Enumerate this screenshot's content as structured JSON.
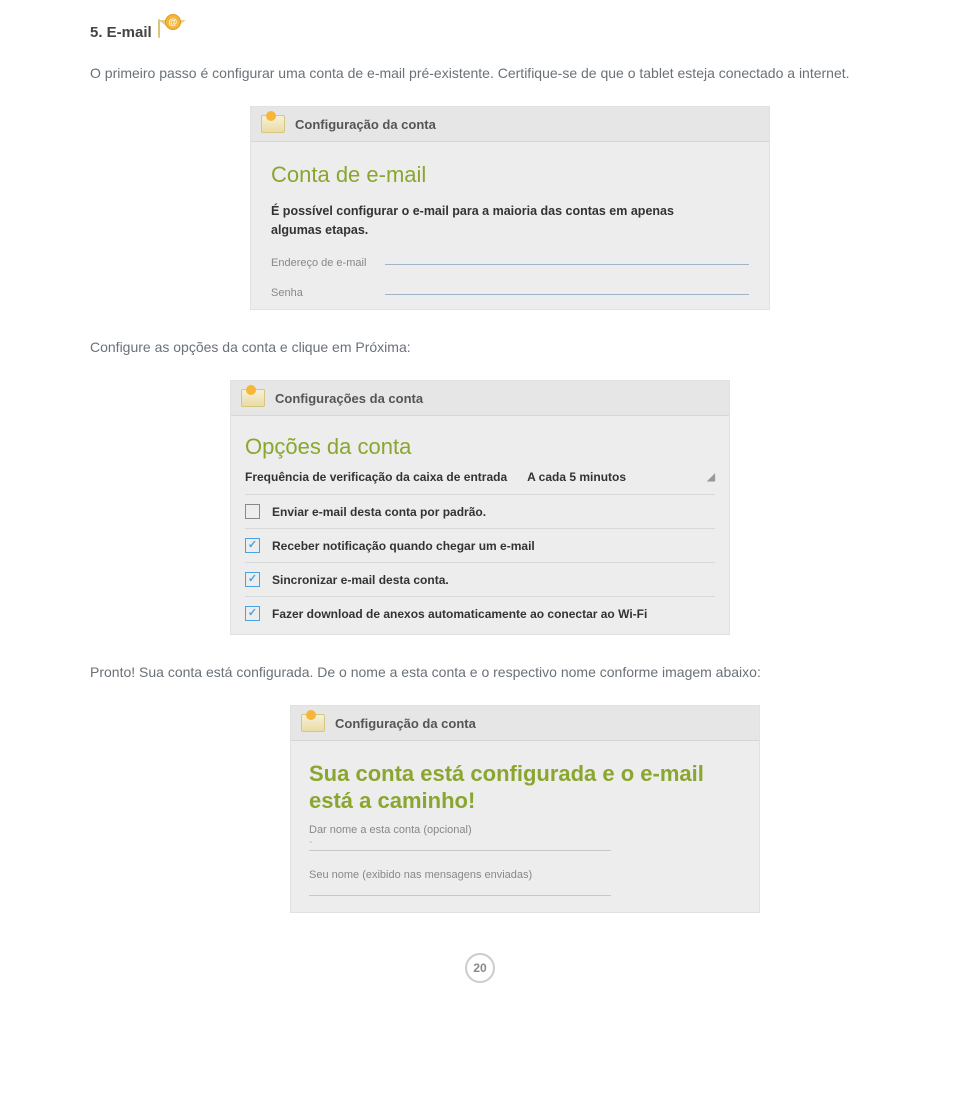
{
  "heading": "5. E-mail",
  "intro": "O primeiro passo é configurar uma conta de e-mail pré-existente. Certifique-se de que o tablet esteja conectado a internet.",
  "shot1": {
    "titlebar": "Configuração da conta",
    "title": "Conta de e-mail",
    "desc": "É possível configurar o e-mail para a maioria das contas em apenas algumas etapas.",
    "field_email": "Endereço de e-mail",
    "field_password": "Senha"
  },
  "mid_text": "Configure as opções da conta e clique em Próxima:",
  "shot2": {
    "titlebar": "Configurações da conta",
    "title": "Opções da conta",
    "freq_label": "Frequência de verificação da caixa de entrada",
    "freq_value": "A cada 5 minutos",
    "options": [
      {
        "checked": false,
        "label": "Enviar e-mail desta conta por padrão."
      },
      {
        "checked": true,
        "label": "Receber notificação quando chegar um e-mail"
      },
      {
        "checked": true,
        "label": "Sincronizar e-mail desta conta."
      },
      {
        "checked": true,
        "label": "Fazer download de anexos automaticamente ao conectar ao Wi-Fi"
      }
    ]
  },
  "after_text": "Pronto! Sua conta está configurada. De o nome a esta conta e o respectivo nome conforme imagem abaixo:",
  "shot3": {
    "titlebar": "Configuração da conta",
    "title": "Sua conta está configurada e o e-mail está a caminho!",
    "field_acct": "Dar nome a esta conta (opcional)",
    "field_acct_value": "-",
    "field_name": "Seu nome (exibido nas mensagens enviadas)"
  },
  "page_number": "20"
}
